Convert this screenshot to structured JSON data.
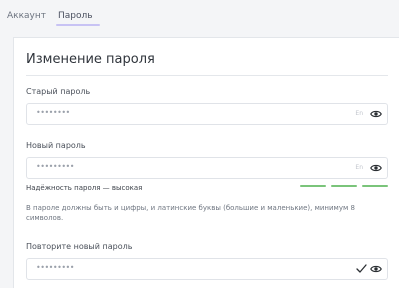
{
  "tabs": [
    {
      "label": "Аккаунт",
      "active": false
    },
    {
      "label": "Пароль",
      "active": true
    }
  ],
  "form": {
    "title": "Изменение пароля",
    "old_password": {
      "label": "Старый пароль",
      "value": "••••••••",
      "lang": "En",
      "icon": "eye-icon"
    },
    "new_password": {
      "label": "Новый пароль",
      "value": "•••••••••",
      "lang": "En",
      "icon": "eye-icon",
      "strength_label": "Надёжность пароля — высокая",
      "strength_level": 3,
      "strength_max": 3
    },
    "hint": "В пароле должны быть и цифры, и латинские буквы (большие и маленькие), минимум 8 символов.",
    "repeat_password": {
      "label": "Повторите новый пароль",
      "value": "•••••••••",
      "icon": "eye-icon",
      "status_icon": "check-icon"
    }
  },
  "colors": {
    "accent": "#c8c3f4",
    "strength": "#7ac47a",
    "background": "#f4f5f7",
    "card": "#ffffff"
  }
}
